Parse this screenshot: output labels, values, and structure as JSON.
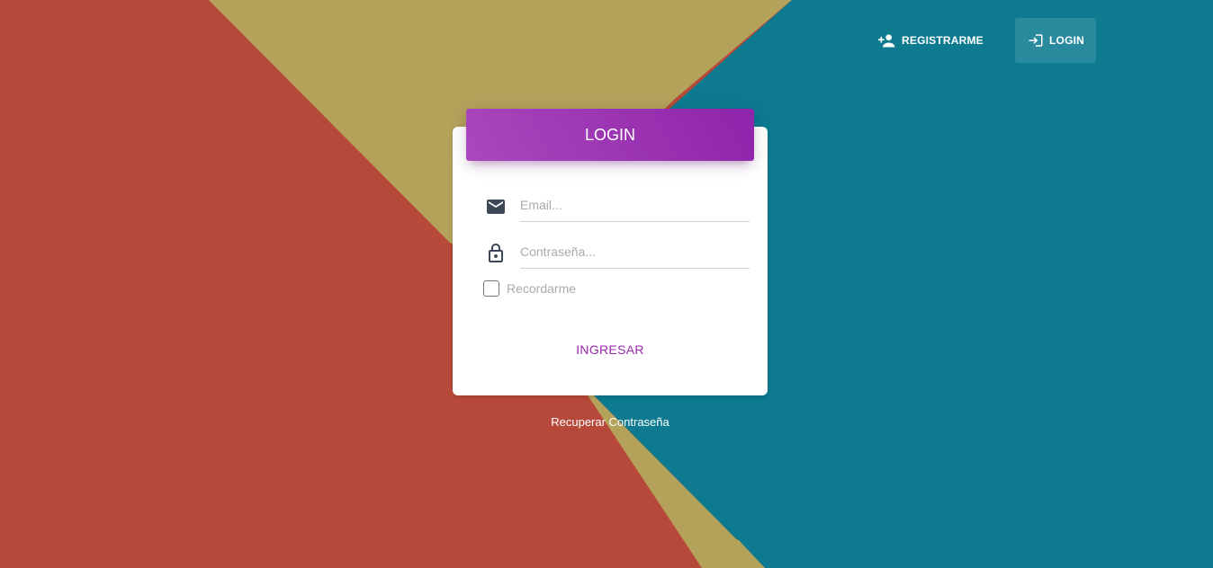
{
  "nav": {
    "register_label": "REGISTRARME",
    "login_label": "LOGIN",
    "register_icon": "person-add-icon",
    "login_icon": "login-arrow-icon"
  },
  "card": {
    "title": "LOGIN",
    "email_placeholder": "Email...",
    "email_icon": "mail-icon",
    "password_placeholder": "Contraseña...",
    "password_icon": "lock-icon",
    "remember_label": "Recordarme",
    "submit_label": "INGRESAR"
  },
  "recover_label": "Recuperar Contraseña",
  "colors": {
    "accent": "#9c27b0",
    "background_red": "#b84a3c",
    "background_yellow": "#b3a35a",
    "background_teal": "#0e7a91"
  }
}
